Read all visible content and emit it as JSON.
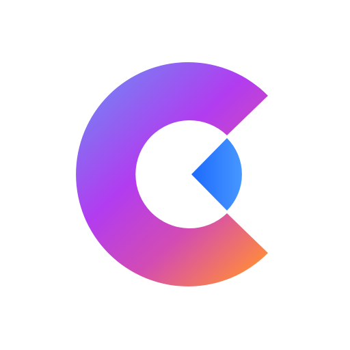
{
  "logo": {
    "icon": "gradient-c-logo-icon",
    "ring_gradient": {
      "colors": [
        "#7a7cf2",
        "#b23cf0",
        "#d24bb4",
        "#ff8a3c"
      ]
    },
    "wedge_gradient": {
      "colors": [
        "#1f6cff",
        "#4a9bff"
      ]
    },
    "background_color": "#ffffff"
  }
}
